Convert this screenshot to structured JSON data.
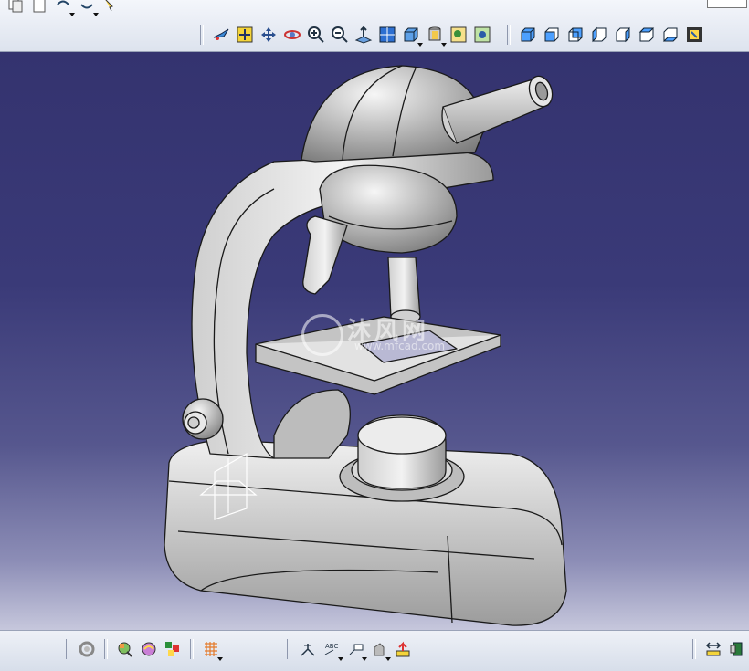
{
  "toolbar_top": {
    "view_icons": [
      "fly-mode-icon",
      "fit-all-icon",
      "pan-icon",
      "rotate-icon",
      "zoom-in-icon",
      "zoom-out-icon",
      "normal-view-icon",
      "multi-view-icon",
      "quick-view-icon",
      "render-style-icon",
      "hide-show-icon",
      "swap-space-icon"
    ],
    "orient_icons": [
      "iso-view-icon",
      "front-view-icon",
      "back-view-icon",
      "left-view-icon",
      "right-view-icon",
      "top-view-icon",
      "bottom-view-icon",
      "named-views-icon"
    ]
  },
  "toolbar_bottom": {
    "icons_a": [
      "update-icon"
    ],
    "icons_b": [
      "catalog-icon",
      "material-icon",
      "apply-material-icon"
    ],
    "icons_c": [
      "grid-icon"
    ],
    "icons_d": [
      "measure-between-icon",
      "annotation-text-icon",
      "flag-note-icon",
      "sketch-tools-icon",
      "analysis-icon"
    ],
    "icons_e": [
      "measure-item-icon",
      "compass-icon"
    ]
  },
  "watermark": {
    "text": "沐风网",
    "url": "www.mfcad.com"
  },
  "colors": {
    "viewport_top": "#34336f",
    "viewport_bottom": "#c6c7dc",
    "model_fill": "#d9d9d9",
    "model_edge": "#1a1a1a"
  }
}
